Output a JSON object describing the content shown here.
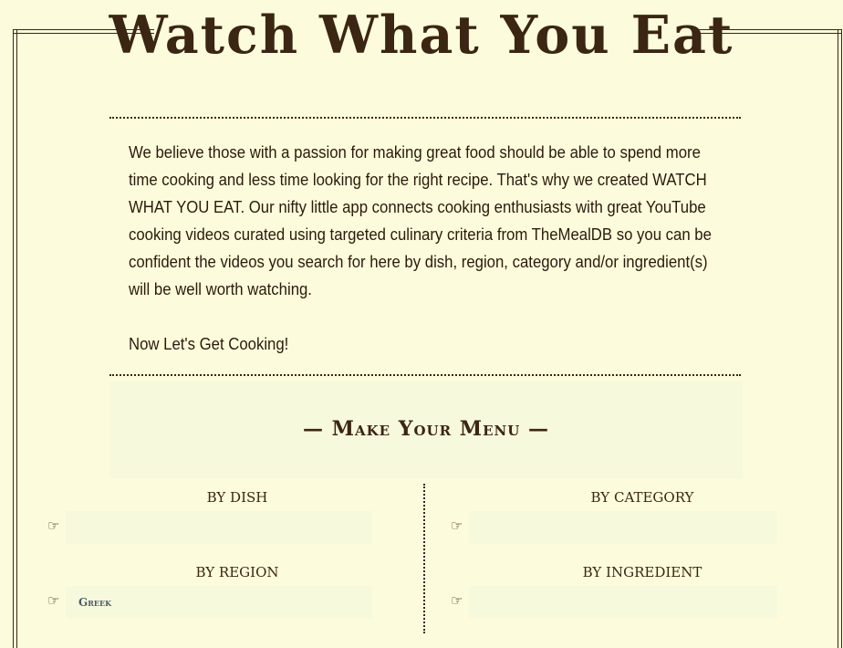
{
  "header": {
    "title": "Watch What You Eat"
  },
  "intro": {
    "paragraph": "We believe those with a passion for making great food should be able to spend more time cooking and less time looking for the right recipe. That's why we created WATCH WHAT YOU EAT. Our nifty little app connects cooking enthusiasts with great YouTube cooking videos curated using targeted culinary criteria from TheMealDB so you can be confident the videos you search for here by dish, region, category and/or ingredient(s) will be well worth watching.",
    "call_to_action": "Now Let's Get Cooking!"
  },
  "menu": {
    "heading": "— Make Your Menu —",
    "by_dish": {
      "label": "BY DISH",
      "icon": "pointing-hand-icon",
      "value": ""
    },
    "by_category": {
      "label": "BY CATEGORY",
      "icon": "pointing-hand-icon",
      "value": ""
    },
    "by_region": {
      "label": "BY REGION",
      "icon": "pointing-hand-icon",
      "value": "Greek"
    },
    "by_ingredient": {
      "label": "BY INGREDIENT",
      "icon": "pointing-hand-icon",
      "value": ""
    }
  },
  "colors": {
    "background": "#fcfcdc",
    "panel": "#f7f9dc",
    "text": "#3b2513",
    "selected_value": "#4a5a6a"
  }
}
